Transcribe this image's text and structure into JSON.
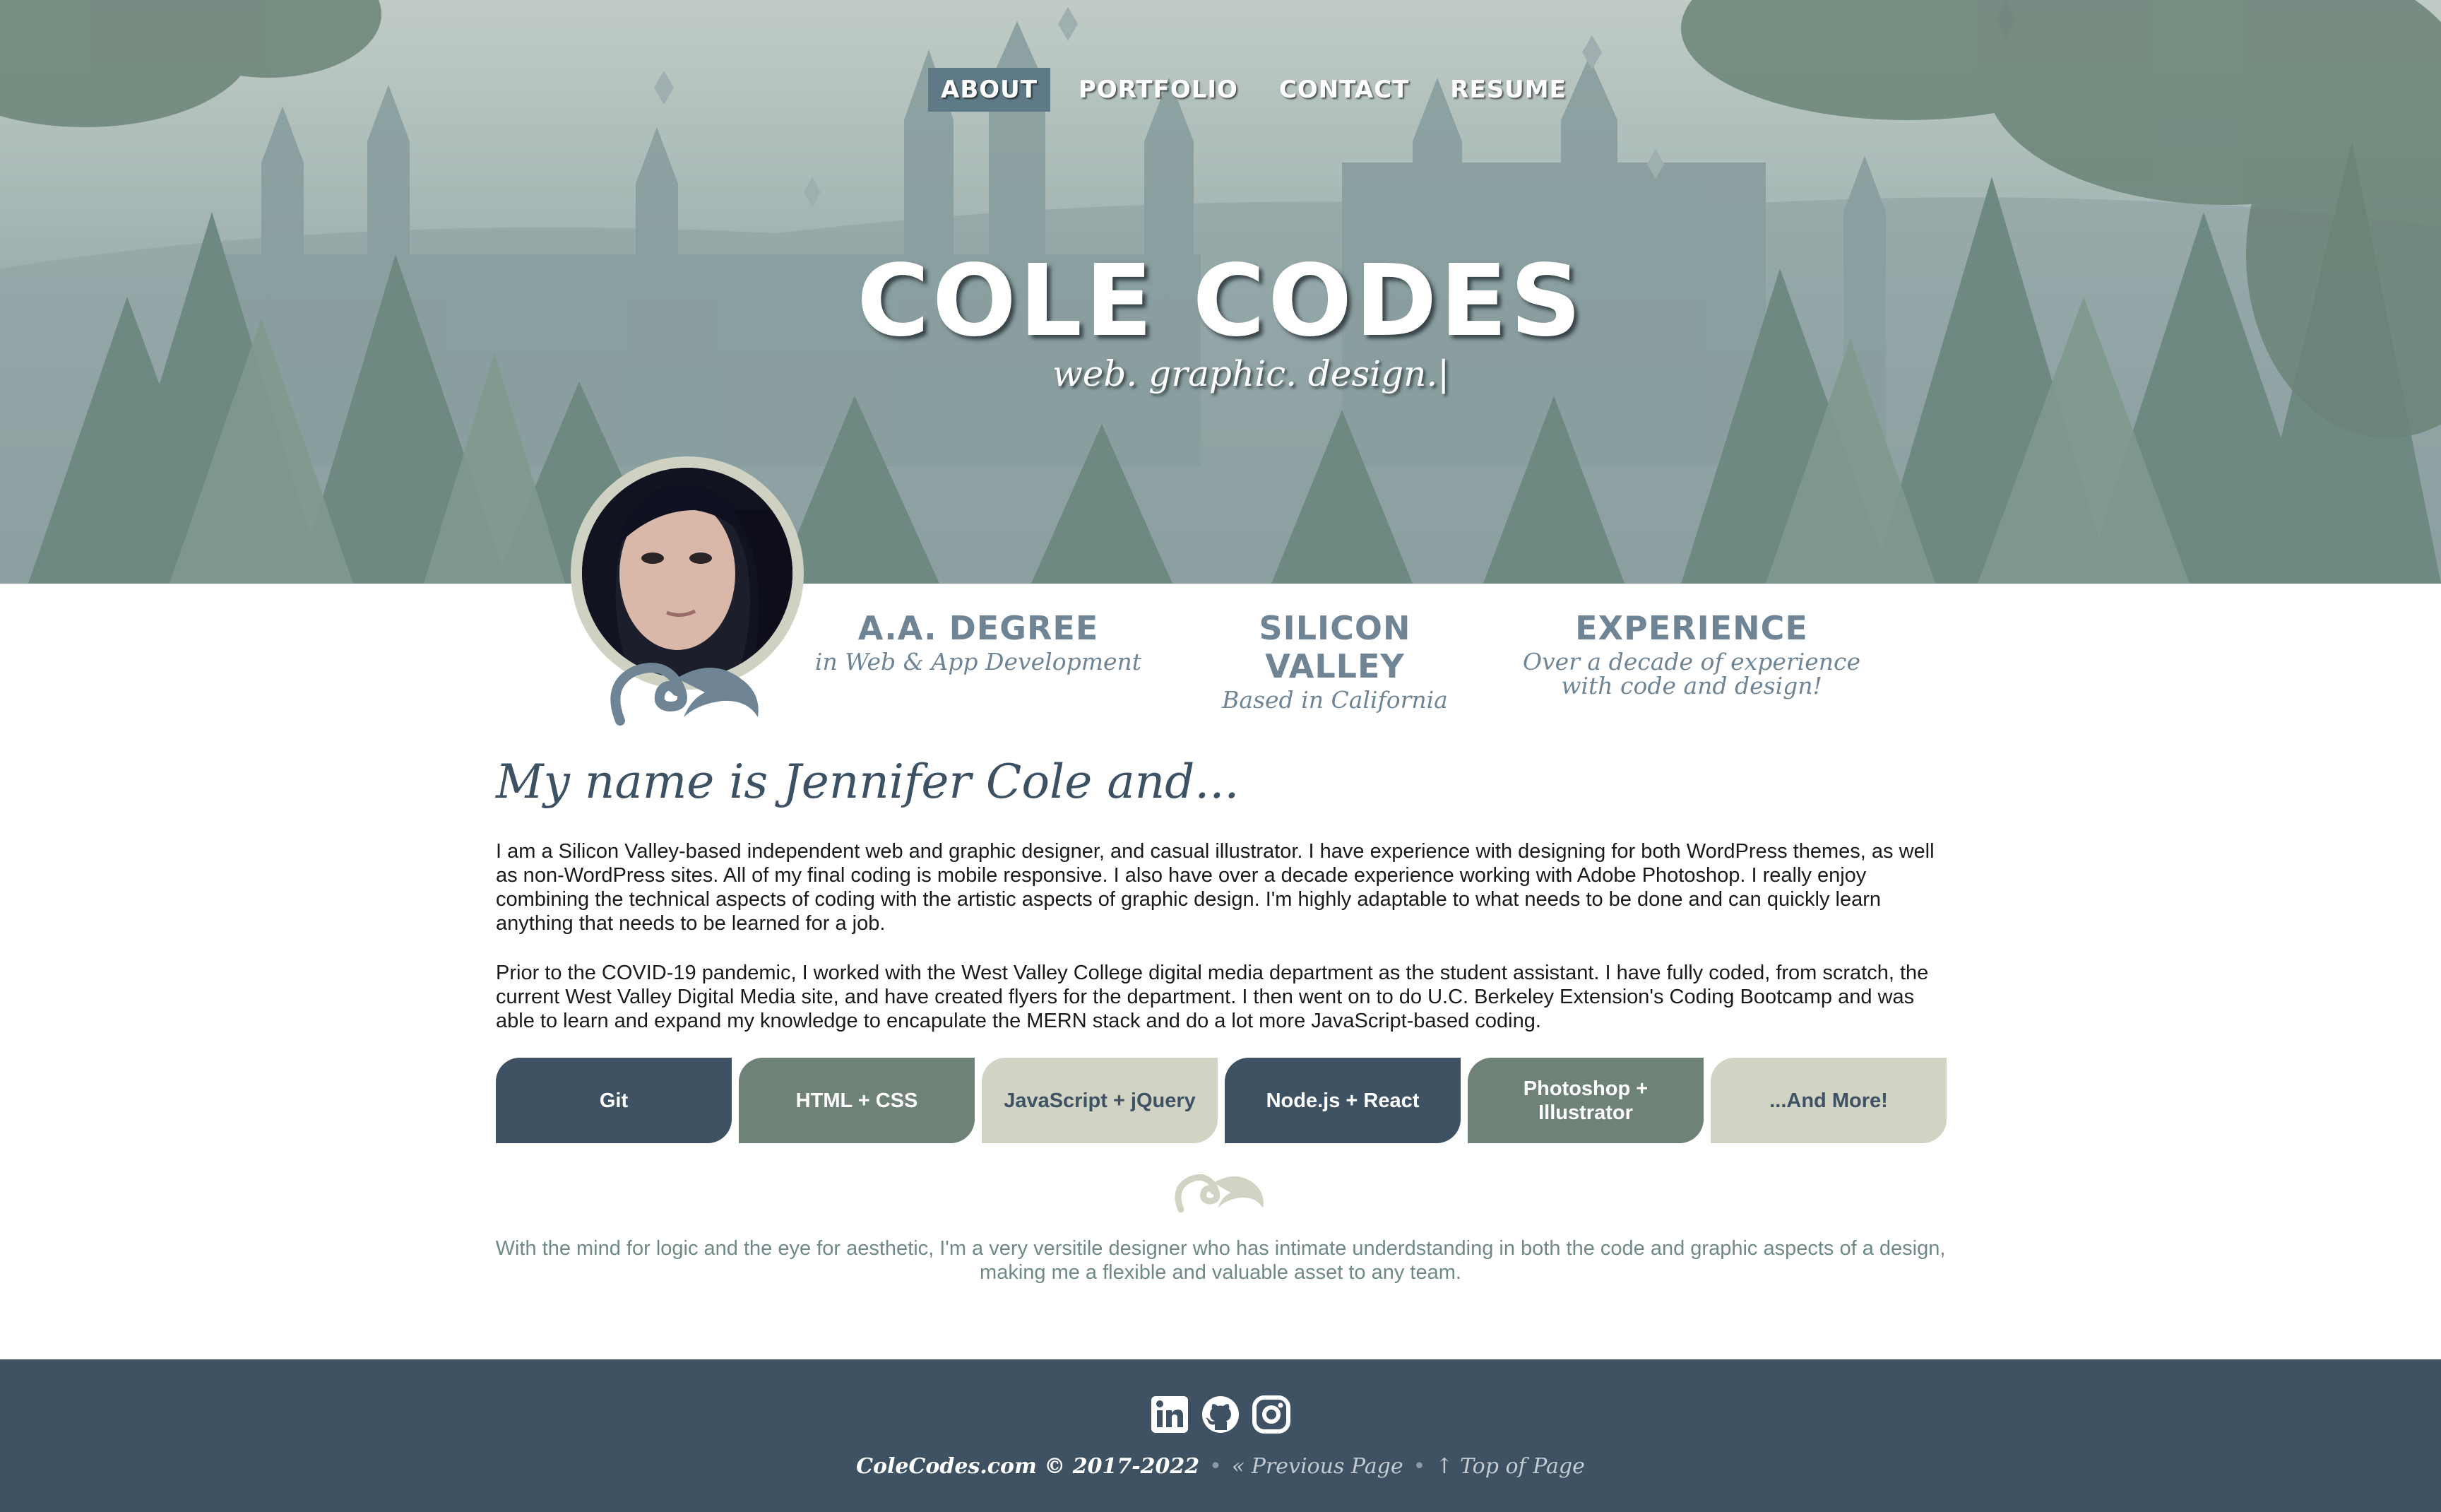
{
  "nav": {
    "items": [
      {
        "label": "ABOUT",
        "active": true
      },
      {
        "label": "PORTFOLIO",
        "active": false
      },
      {
        "label": "CONTACT",
        "active": false
      },
      {
        "label": "RESUME",
        "active": false
      }
    ]
  },
  "hero": {
    "title": "COLE CODES",
    "tagline": "web. graphic. design.",
    "cursor": "|"
  },
  "stats": [
    {
      "title": "A.A. DEGREE",
      "subtitle": "in Web & App Development"
    },
    {
      "title": "SILICON VALLEY",
      "subtitle": "Based in California"
    },
    {
      "title": "EXPERIENCE",
      "subtitle": "Over a decade of experience with code and design!"
    }
  ],
  "about": {
    "heading": "My name is Jennifer Cole and...",
    "paragraphs": [
      "I am a Silicon Valley-based independent web and graphic designer, and casual illustrator. I have experience with designing for both WordPress themes, as well as non-WordPress sites. All of my final coding is mobile responsive. I also have over a decade experience working with Adobe Photoshop. I really enjoy combining the technical aspects of coding with the artistic aspects of graphic design. I'm highly adaptable to what needs to be done and can quickly learn anything that needs to be learned for a job.",
      "Prior to the COVID-19 pandemic, I worked with the West Valley College digital media department as the student assistant. I have fully coded, from scratch, the current West Valley Digital Media site, and have created flyers for the department. I then went on to do U.C. Berkeley Extension's Coding Bootcamp and was able to learn and expand my knowledge to encapulate the MERN stack and do a lot more JavaScript-based coding."
    ]
  },
  "skills": [
    {
      "label": "Git",
      "bg": "#3e5264",
      "fg": "#ffffff"
    },
    {
      "label": "HTML + CSS",
      "bg": "#6e8278",
      "fg": "#ffffff"
    },
    {
      "label": "JavaScript + jQuery",
      "bg": "#d1d3c4",
      "fg": "#3e5264"
    },
    {
      "label": "Node.js + React",
      "bg": "#3e5264",
      "fg": "#ffffff"
    },
    {
      "label": "Photoshop + Illustrator",
      "bg": "#6e8278",
      "fg": "#ffffff"
    },
    {
      "label": "...And More!",
      "bg": "#d1d3c4",
      "fg": "#3e5264"
    }
  ],
  "quote": "With the mind for logic and the eye for aesthetic, I'm a very versitile designer who has intimate underdstanding in both the code and graphic aspects of a design, making me a flexible and valuable asset to any team.",
  "footer": {
    "social": [
      "linkedin-icon",
      "github-icon",
      "instagram-icon"
    ],
    "copyright": "ColeCodes.com © 2017-2022",
    "prev_icon": "«",
    "prev_label": "Previous Page",
    "top_icon": "↑",
    "top_label": "Top of Page"
  },
  "colors": {
    "navy": "#3e5264",
    "sage": "#6e8278",
    "cream": "#d1d3c4",
    "stat_text": "#6f8595"
  }
}
